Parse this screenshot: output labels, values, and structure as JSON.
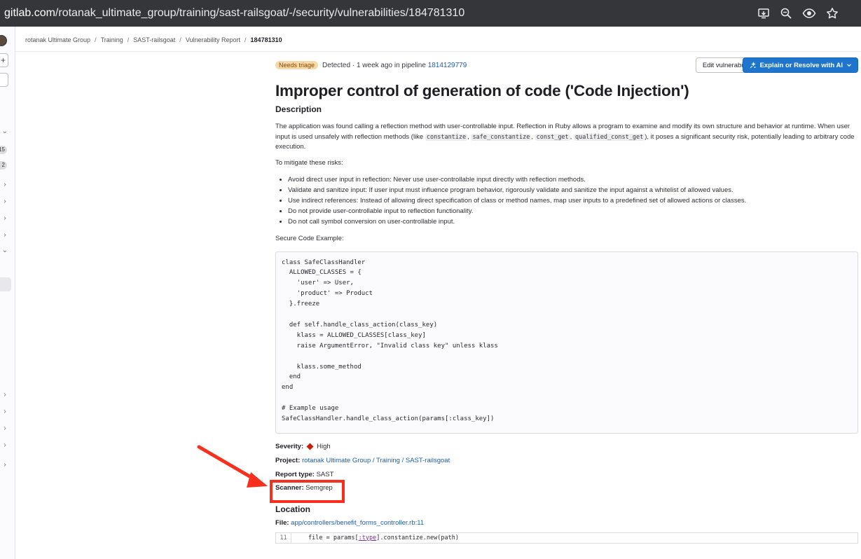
{
  "browser": {
    "url_host": "gitlab.com",
    "url_path": "/rotanak_ultimate_group/training/sast-railsgoat/-/security/vulnerabilities/184781310"
  },
  "breadcrumb": {
    "items": [
      "rotanak Ultimate Group",
      "Training",
      "SAST-railsgoat",
      "Vulnerability Report"
    ],
    "current": "184781310",
    "separator": "/"
  },
  "sidebar": {
    "counts": [
      "15",
      "2"
    ]
  },
  "header": {
    "status_badge": "Needs triage",
    "detected_text": "Detected · 1 week ago in pipeline",
    "pipeline_id": "1814129779",
    "edit_button": "Edit vulnerability",
    "ai_button": "Explain or Resolve with AI"
  },
  "title": "Improper control of generation of code ('Code Injection')",
  "description": {
    "heading": "Description",
    "p1_a": "The application was found calling a reflection method with user-controllable input. Reflection in Ruby allows a program to examine and modify its own structure and behavior at runtime. When user input is used unsafely with reflection methods (like ",
    "code1": "constantize",
    "code2": "safe_constantize",
    "code3": "const_get",
    "code4": "qualified_const_get",
    "p1_b": "), it poses a significant security risk, potentially leading to arbitrary code execution.",
    "sep_comma": ",",
    "mitigate": "To mitigate these risks:",
    "bullets": [
      "Avoid direct user input in reflection: Never use user-controllable input directly with reflection methods.",
      "Validate and sanitize input: If user input must influence program behavior, rigorously validate and sanitize the input against a whitelist of allowed values.",
      "Use indirect references: Instead of allowing direct specification of class or method names, map user inputs to a predefined set of allowed actions or classes.",
      "Do not provide user-controllable input to reflection functionality.",
      "Do not call symbol conversion on user-controllable input."
    ],
    "secure_example_label": "Secure Code Example:",
    "code_block": "class SafeClassHandler\n  ALLOWED_CLASSES = {\n    'user' => User,\n    'product' => Product\n  }.freeze\n\n  def self.handle_class_action(class_key)\n    klass = ALLOWED_CLASSES[class_key]\n    raise ArgumentError, \"Invalid class key\" unless klass\n\n    klass.some_method\n  end\nend\n\n# Example usage\nSafeClassHandler.handle_class_action(params[:class_key])"
  },
  "details": {
    "severity_label": "Severity:",
    "severity_value": "High",
    "project_label": "Project:",
    "project_value": "rotanak Ultimate Group / Training / SAST-railsgoat",
    "report_type_label": "Report type:",
    "report_type_value": "SAST",
    "scanner_label": "Scanner:",
    "scanner_value": "Semgrep"
  },
  "location": {
    "heading": "Location",
    "file_label": "File:",
    "file_value": "app/controllers/benefit_forms_controller.rb:11",
    "line_number": "11",
    "code_pre": "file = params[",
    "code_sym": ":type",
    "code_post": "].constantize.new(path)"
  },
  "colors": {
    "accent": "#1f75cb",
    "severity_high": "#c91c00",
    "annotation": "#f7301e",
    "badge_bg": "#f5d9a8"
  }
}
